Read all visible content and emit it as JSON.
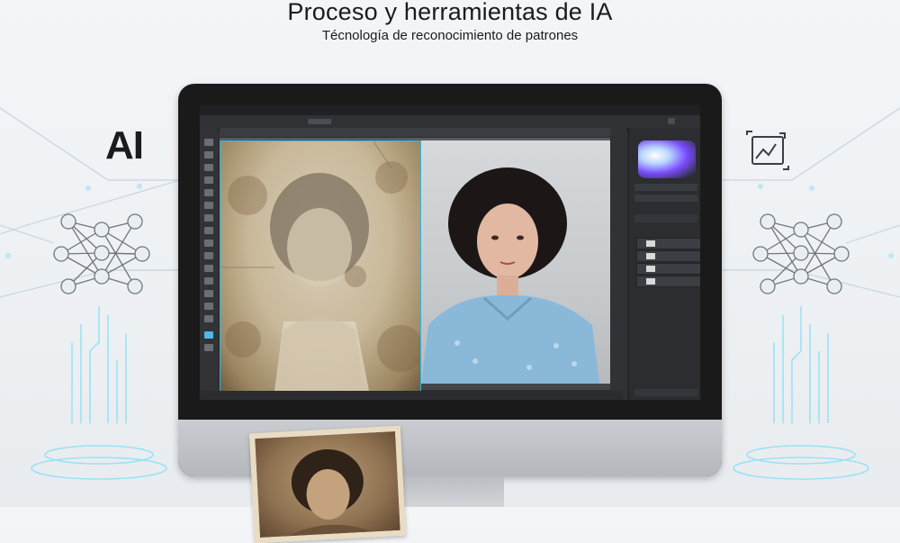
{
  "header": {
    "title": "Proceso y herramientas de IA",
    "subtitle": "Técnología de reconocimiento de patrones"
  },
  "badges": {
    "ai_label": "AI"
  },
  "editor": {
    "accent_color": "#2fb6e0",
    "selected_tool_color": "#4fb8e6"
  }
}
